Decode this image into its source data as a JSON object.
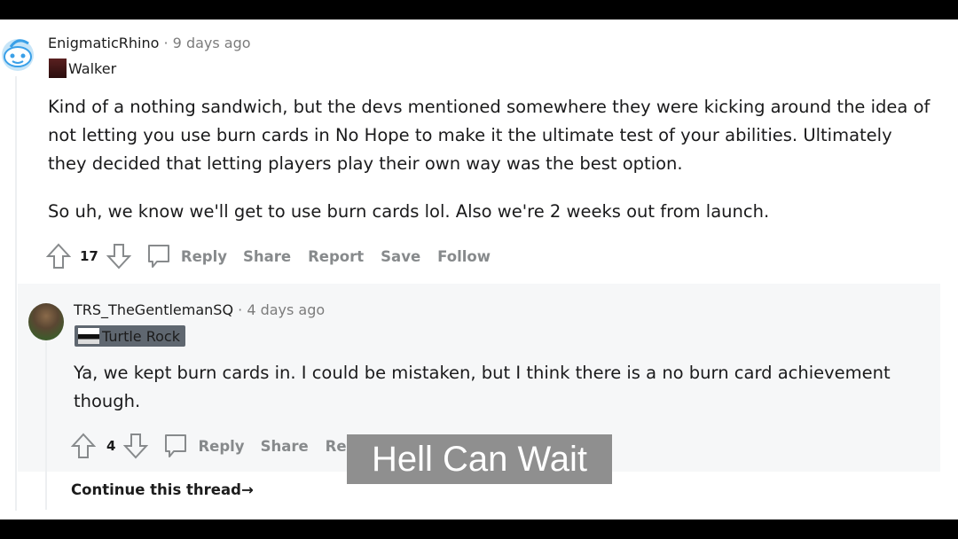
{
  "comments": [
    {
      "author": "EnigmaticRhino",
      "time": "9 days ago",
      "flair": "Walker",
      "paragraphs": [
        "Kind of a nothing sandwich, but the devs mentioned somewhere they were kicking around the idea of not letting you use burn cards in No Hope to make it the ultimate test of your abilities. Ultimately they decided that letting players play their own way was the best option.",
        "So uh, we know we'll get to use burn cards lol. Also we're 2 weeks out from launch."
      ],
      "votes": "17"
    },
    {
      "author": "TRS_TheGentlemanSQ",
      "time": "4 days ago",
      "flair": "Turtle Rock",
      "paragraphs": [
        "Ya, we kept burn cards in. I could be mistaken, but I think there is a no burn card achievement though."
      ],
      "votes": "4"
    }
  ],
  "actions": {
    "reply": "Reply",
    "share": "Share",
    "report": "Report",
    "save": "Save",
    "follow": "Follow"
  },
  "sep": "·",
  "continue_thread": "Continue this thread",
  "continue_arrow": "→",
  "caption": "Hell Can Wait",
  "colors": {
    "reply_bg": "#f6f7f8",
    "action_gray": "#878a8c",
    "caption_bg": "#8f8f8f"
  }
}
